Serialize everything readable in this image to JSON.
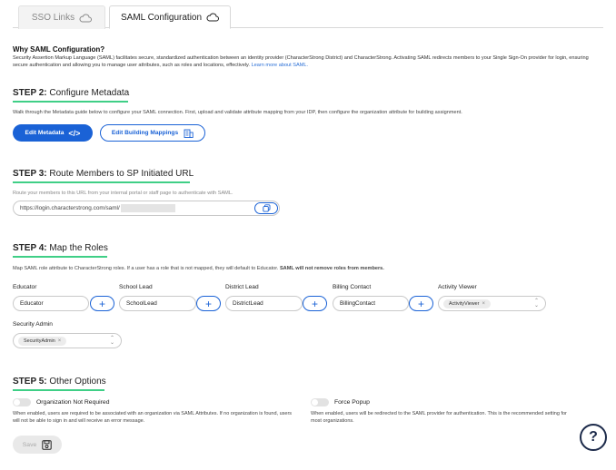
{
  "tabs": [
    {
      "label": "SSO Links",
      "icon": "cloud-icon"
    },
    {
      "label": "SAML Configuration",
      "icon": "cloud-icon"
    }
  ],
  "why": {
    "title": "Why SAML Configuration?",
    "text": "Security Assertion Markup Language (SAML) facilitates secure, standardized authentication between an identity provider (CharacterStrong District) and CharacterStrong. Activating SAML redirects members to your Single Sign-On provider for login, ensuring secure authentication and allowing you to manage user attributes, such as roles and locations, effectively.",
    "link": "Learn more about SAML."
  },
  "step2": {
    "prefix": "STEP 2:",
    "title": "Configure Metadata",
    "desc": "Walk through the Metadata guide below to configure your SAML connection. First, upload and validate attribute mapping from your IDP, then configure the organization attribute for building assignment.",
    "edit_metadata_label": "Edit Metadata",
    "edit_building_label": "Edit Building Mappings"
  },
  "step3": {
    "prefix": "STEP 3:",
    "title": "Route Members to SP Initiated URL",
    "desc": "Route your members to this URL from your internal portal or staff page to authenticate with SAML.",
    "url": "https://login.characterstrong.com/saml/"
  },
  "step4": {
    "prefix": "STEP 4:",
    "title": "Map the Roles",
    "desc": "Map SAML role attribute to CharacterStrong roles. If a user has a role that is not mapped, they will default to Educator.",
    "desc_bold": "SAML will not remove roles from members.",
    "roles": [
      {
        "label": "Educator",
        "value": "Educator"
      },
      {
        "label": "School Lead",
        "value": "SchoolLead"
      },
      {
        "label": "District Lead",
        "value": "DistrictLead"
      },
      {
        "label": "Billing Contact",
        "value": "BillingContact"
      }
    ],
    "activity_viewer": {
      "label": "Activity Viewer",
      "chip": "ActivityViewer"
    },
    "security_admin": {
      "label": "Security Admin",
      "chip": "SecurityAdmin"
    }
  },
  "step5": {
    "prefix": "STEP 5:",
    "title": "Other Options",
    "org_not_required": {
      "label": "Organization Not Required",
      "desc": "When enabled, users are required to be associated with an organization via SAML Attributes. If no organization is found, users will not be able to sign in and will receive an error message."
    },
    "force_popup": {
      "label": "Force Popup",
      "desc": "When enabled, users will be redirected to the SAML provider for authentication. This is the recommended setting for most organizations."
    }
  },
  "save_label": "Save",
  "help_label": "?",
  "colors": {
    "accent": "#1a62d6",
    "underline": "#3fcf86",
    "help": "#1c2a4a"
  }
}
